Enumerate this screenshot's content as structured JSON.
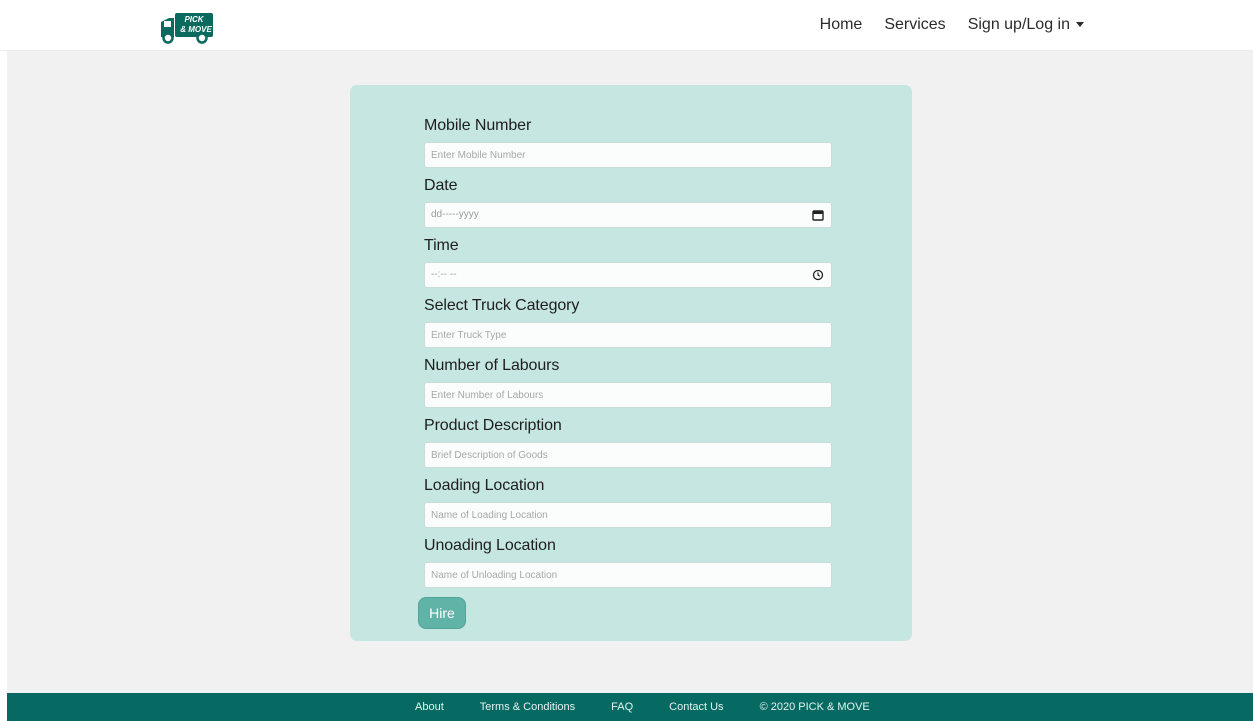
{
  "header": {
    "logo_icon": "truck-logo-icon",
    "logo_line1": "PICK",
    "logo_line2": "& MOVE",
    "nav": {
      "home": "Home",
      "services": "Services",
      "account": "Sign up/Log in"
    }
  },
  "form": {
    "fields": [
      {
        "label": "Mobile Number",
        "placeholder": "Enter Mobile Number"
      },
      {
        "label": "Date",
        "placeholder": "dd-----yyyy",
        "icon": "calendar-icon"
      },
      {
        "label": "Time",
        "placeholder": "--:-- --",
        "icon": "clock-icon"
      },
      {
        "label": "Select Truck Category",
        "placeholder": "Enter Truck Type"
      },
      {
        "label": "Number of Labours",
        "placeholder": "Enter Number of Labours"
      },
      {
        "label": "Product Description",
        "placeholder": "Brief Description of Goods"
      },
      {
        "label": "Loading Location",
        "placeholder": "Name of Loading Location"
      },
      {
        "label": "Unoading Location",
        "placeholder": "Name of Unloading Location"
      }
    ],
    "submit_label": "Hire"
  },
  "footer": {
    "about": "About",
    "terms": "Terms & Conditions",
    "faq": "FAQ",
    "contact": "Contact Us",
    "copyright": "© 2020 PICK & MOVE"
  },
  "colors": {
    "brand": "#066a62",
    "form_background": "#c6e6e2",
    "button": "#5fb3a7",
    "page_background": "#f1f1f1"
  }
}
